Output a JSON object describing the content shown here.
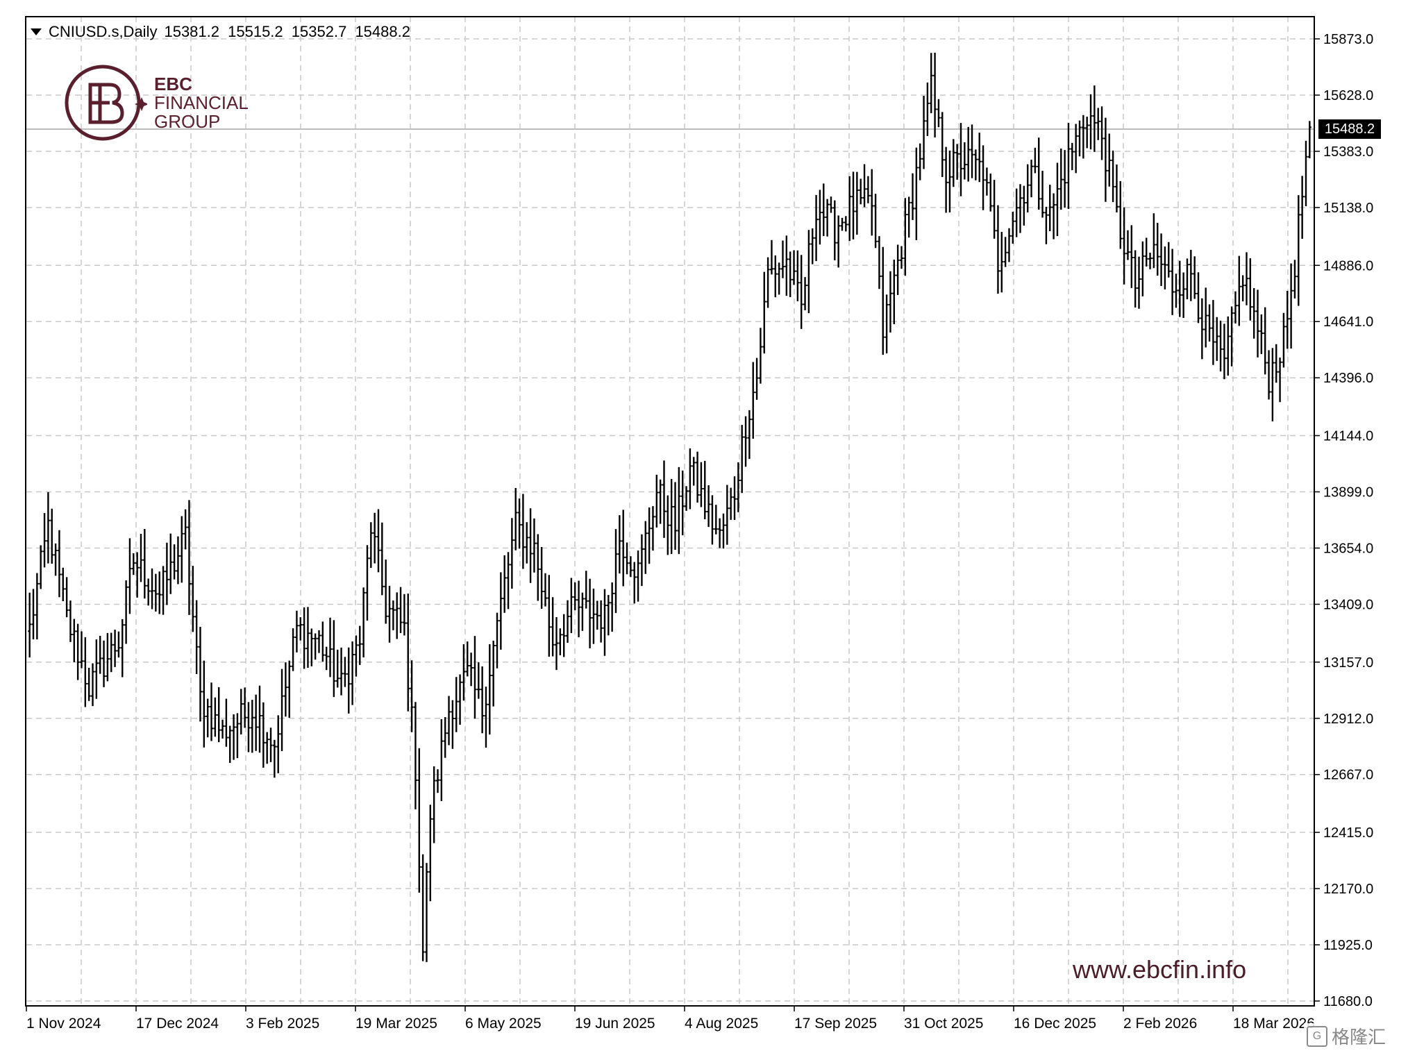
{
  "header": {
    "symbol": "CNIUSD.s,Daily",
    "open": "15381.2",
    "high": "15515.2",
    "low": "15352.7",
    "close": "15488.2"
  },
  "logo": {
    "line1": "EBC",
    "line2": "FINANCIAL",
    "line3": "GROUP",
    "brand_color": "#5a1f2c"
  },
  "watermark": "www.ebcfin.info",
  "corner_mark": "格隆汇",
  "current_price_label": "15488.2",
  "chart_data": {
    "type": "ohlc",
    "title": "CNIUSD.s,Daily",
    "grid": true,
    "y_range": [
      11680,
      15873
    ],
    "y_ticks": [
      "15873.0",
      "15628.0",
      "15383.0",
      "15138.0",
      "14886.0",
      "14641.0",
      "14396.0",
      "14144.0",
      "13899.0",
      "13654.0",
      "13409.0",
      "13157.0",
      "12912.0",
      "12667.0",
      "12415.0",
      "12170.0",
      "11925.0",
      "11680.0"
    ],
    "x_labels": [
      "1 Nov 2024",
      "17 Dec 2024",
      "3 Feb 2025",
      "19 Mar 2025",
      "6 May 2025",
      "19 Jun 2025",
      "4 Aug 2025",
      "17 Sep 2025",
      "31 Oct 2025",
      "16 Dec 2025",
      "2 Feb 2026",
      "18 Mar 2026"
    ],
    "bar_count": 346,
    "anchors": [
      {
        "bar": 0,
        "close": 13300
      },
      {
        "bar": 5,
        "close": 13750
      },
      {
        "bar": 10,
        "close": 13350
      },
      {
        "bar": 16,
        "close": 13050
      },
      {
        "bar": 24,
        "close": 13250
      },
      {
        "bar": 28,
        "close": 13600
      },
      {
        "bar": 35,
        "close": 13450
      },
      {
        "bar": 42,
        "close": 13700
      },
      {
        "bar": 46,
        "close": 13000
      },
      {
        "bar": 52,
        "close": 12850
      },
      {
        "bar": 60,
        "close": 12950
      },
      {
        "bar": 66,
        "close": 12800
      },
      {
        "bar": 72,
        "close": 13300
      },
      {
        "bar": 78,
        "close": 13250
      },
      {
        "bar": 84,
        "close": 13050
      },
      {
        "bar": 89,
        "close": 13250
      },
      {
        "bar": 92,
        "close": 13750
      },
      {
        "bar": 96,
        "close": 13400
      },
      {
        "bar": 101,
        "close": 13300
      },
      {
        "bar": 104,
        "close": 12700
      },
      {
        "bar": 106,
        "close": 11900
      },
      {
        "bar": 108,
        "close": 12500
      },
      {
        "bar": 113,
        "close": 12950
      },
      {
        "bar": 118,
        "close": 13100
      },
      {
        "bar": 122,
        "close": 12950
      },
      {
        "bar": 128,
        "close": 13500
      },
      {
        "bar": 131,
        "close": 13750
      },
      {
        "bar": 136,
        "close": 13650
      },
      {
        "bar": 141,
        "close": 13250
      },
      {
        "bar": 147,
        "close": 13400
      },
      {
        "bar": 155,
        "close": 13350
      },
      {
        "bar": 159,
        "close": 13700
      },
      {
        "bar": 164,
        "close": 13550
      },
      {
        "bar": 169,
        "close": 13900
      },
      {
        "bar": 174,
        "close": 13750
      },
      {
        "bar": 178,
        "close": 14000
      },
      {
        "bar": 183,
        "close": 13800
      },
      {
        "bar": 186,
        "close": 13700
      },
      {
        "bar": 190,
        "close": 13900
      },
      {
        "bar": 193,
        "close": 14200
      },
      {
        "bar": 196,
        "close": 14400
      },
      {
        "bar": 199,
        "close": 14850
      },
      {
        "bar": 204,
        "close": 14900
      },
      {
        "bar": 208,
        "close": 14700
      },
      {
        "bar": 212,
        "close": 15150
      },
      {
        "bar": 217,
        "close": 15050
      },
      {
        "bar": 222,
        "close": 15150
      },
      {
        "bar": 227,
        "close": 15150
      },
      {
        "bar": 230,
        "close": 14600
      },
      {
        "bar": 234,
        "close": 14900
      },
      {
        "bar": 238,
        "close": 15200
      },
      {
        "bar": 243,
        "close": 15650
      },
      {
        "bar": 247,
        "close": 15300
      },
      {
        "bar": 252,
        "close": 15350
      },
      {
        "bar": 257,
        "close": 15300
      },
      {
        "bar": 261,
        "close": 14900
      },
      {
        "bar": 265,
        "close": 15100
      },
      {
        "bar": 270,
        "close": 15300
      },
      {
        "bar": 275,
        "close": 15100
      },
      {
        "bar": 280,
        "close": 15350
      },
      {
        "bar": 285,
        "close": 15550
      },
      {
        "bar": 289,
        "close": 15450
      },
      {
        "bar": 293,
        "close": 15100
      },
      {
        "bar": 298,
        "close": 14800
      },
      {
        "bar": 303,
        "close": 14950
      },
      {
        "bar": 308,
        "close": 14800
      },
      {
        "bar": 313,
        "close": 14850
      },
      {
        "bar": 317,
        "close": 14600
      },
      {
        "bar": 322,
        "close": 14450
      },
      {
        "bar": 327,
        "close": 14850
      },
      {
        "bar": 331,
        "close": 14600
      },
      {
        "bar": 334,
        "close": 14400
      },
      {
        "bar": 338,
        "close": 14550
      },
      {
        "bar": 341,
        "close": 14900
      },
      {
        "bar": 345,
        "close": 15488
      }
    ]
  }
}
